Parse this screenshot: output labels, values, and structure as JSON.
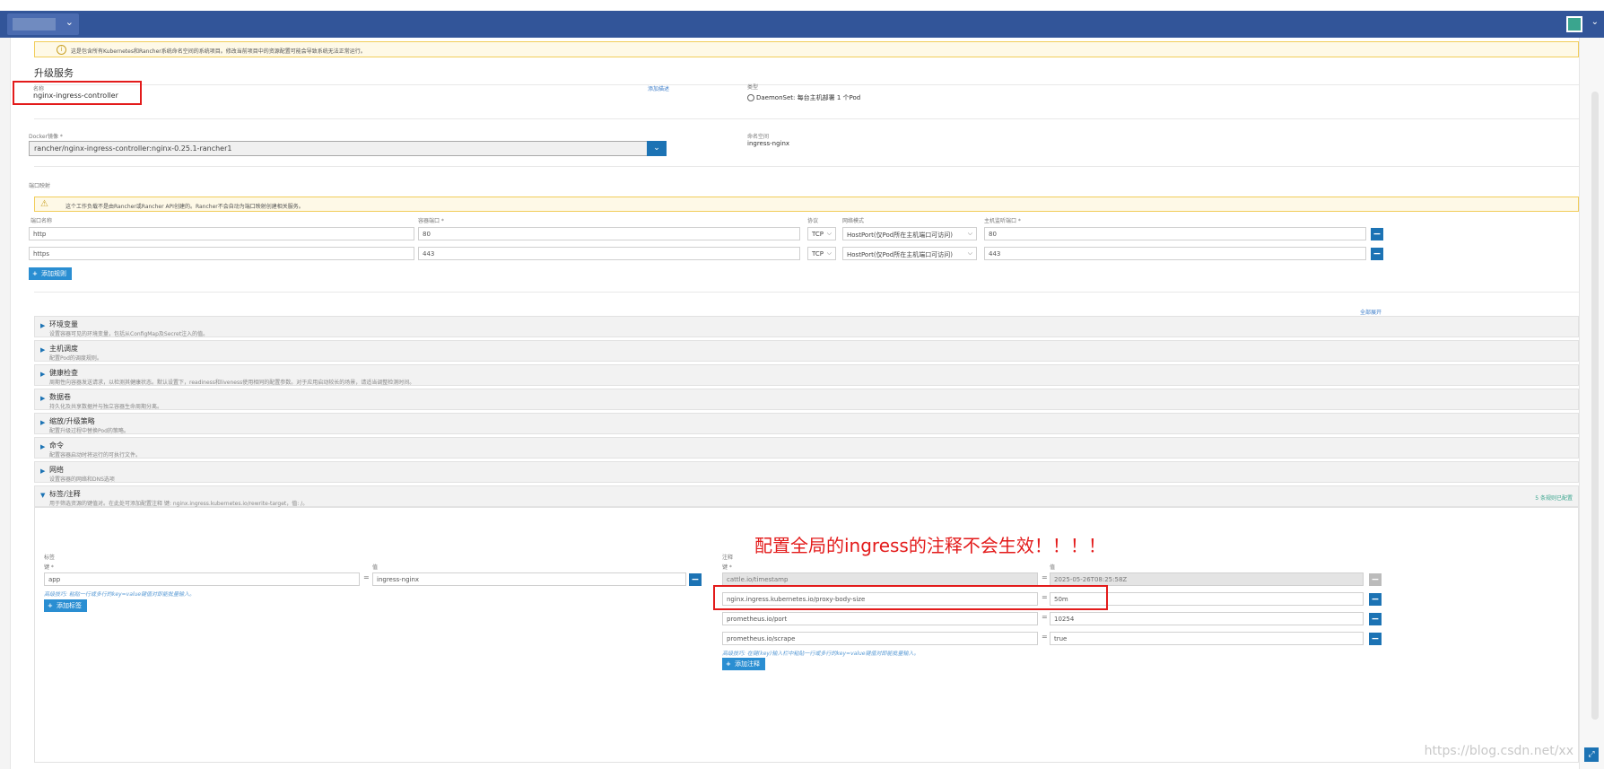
{
  "header": {
    "env_chevron": "⌄",
    "avatar_chevron": "⌄"
  },
  "notice": {
    "text": "这是包含所有Kubernetes和Rancher系统命名空间的系统项目。修改当前项目中的资源配置可能会导致系统无法正常运行。"
  },
  "page": {
    "title": "升级服务"
  },
  "name_section": {
    "name_label": "名称",
    "name_value": "nginx-ingress-controller",
    "add_desc_link": "添加描述",
    "type_label": "类型",
    "type_value": "DaemonSet: 每台主机部署 1 个Pod"
  },
  "image_section": {
    "docker_label": "Docker镜像 *",
    "docker_value": "rancher/nginx-ingress-controller:nginx-0.25.1-rancher1",
    "namespace_label": "命名空间",
    "namespace_value": "ingress-nginx"
  },
  "ports": {
    "section_label": "端口映射",
    "warning": "这个工作负载不是由Rancher或Rancher API创建的。Rancher不会自动为端口映射创建相关服务。",
    "col_name": "端口名称",
    "col_container_port": "容器端口 *",
    "col_protocol": "协议",
    "col_network_mode": "网络模式",
    "col_host_port": "主机监听端口 *",
    "rows": [
      {
        "name": "http",
        "container_port": "80",
        "protocol": "TCP",
        "mode": "HostPort(仅Pod所在主机端口可访问)",
        "host_port": "80"
      },
      {
        "name": "https",
        "container_port": "443",
        "protocol": "TCP",
        "mode": "HostPort(仅Pod所在主机端口可访问)",
        "host_port": "443"
      }
    ],
    "add_rule": "添加规则",
    "expand_all": "全部展开"
  },
  "accordions": [
    {
      "title": "环境变量",
      "desc": "设置容器可见的环境变量，包括从ConfigMap及Secret注入的值。"
    },
    {
      "title": "主机调度",
      "desc": "配置Pod的调度规则。"
    },
    {
      "title": "健康检查",
      "desc": "周期性向容器发送请求，以检测其健康状态。默认设置下，readiness和liveness使用相同的配置参数。对于应用启动较长的场景，请适当调整检测时间。"
    },
    {
      "title": "数据卷",
      "desc": "持久化及共享数据并与独立容器生命周期分离。"
    },
    {
      "title": "缩放/升级策略",
      "desc": "配置升级过程中替换Pod的策略。"
    },
    {
      "title": "命令",
      "desc": "配置容器启动时将运行的可执行文件。"
    },
    {
      "title": "网络",
      "desc": "设置容器的网络和DNS选项"
    }
  ],
  "labels_annotations": {
    "title": "标签/注释",
    "desc": "用于筛选资源的键值对。在此处可添加配置注释 键: nginx.ingress.kubernetes.io/rewrite-target，值: /。",
    "count": "5 条规则已配置",
    "labels": {
      "heading": "标签",
      "key_label": "键 *",
      "value_label": "值",
      "rows": [
        {
          "key": "app",
          "value": "ingress-nginx"
        }
      ],
      "hint": "高级技巧: 粘贴一行或多行的key=value键值对即能批量输入。",
      "add_button": "添加标签"
    },
    "annotations": {
      "heading": "注释",
      "key_label": "键 *",
      "value_label": "值",
      "rows": [
        {
          "key": "cattle.io/timestamp",
          "value": "2025-05-26T08:25:58Z",
          "readonly": true
        },
        {
          "key": "nginx.ingress.kubernetes.io/proxy-body-size",
          "value": "50m",
          "readonly": false
        },
        {
          "key": "prometheus.io/port",
          "value": "10254",
          "readonly": false
        },
        {
          "key": "prometheus.io/scrape",
          "value": "true",
          "readonly": false
        }
      ],
      "hint": "高级技巧: 在键(key)输入栏中粘贴一行或多行的key=value键值对即能批量输入。",
      "add_button": "添加注释"
    }
  },
  "annotation_overlay": {
    "text": "配置全局的ingress的注释不会生效！！！！",
    "color": "#e31b1b"
  },
  "watermark": "https://blog.csdn.net/xx",
  "icons": {
    "minus": "−",
    "plus": "+",
    "chevron_down": "⌄",
    "triangle_right": "▶",
    "triangle_down": "▼",
    "warning": "⚠",
    "info": "i",
    "select_chevron": "⌵"
  },
  "colors": {
    "topbar": "#325599",
    "primary_button": "#1c73b4",
    "annotation_red": "#e31b1b"
  }
}
